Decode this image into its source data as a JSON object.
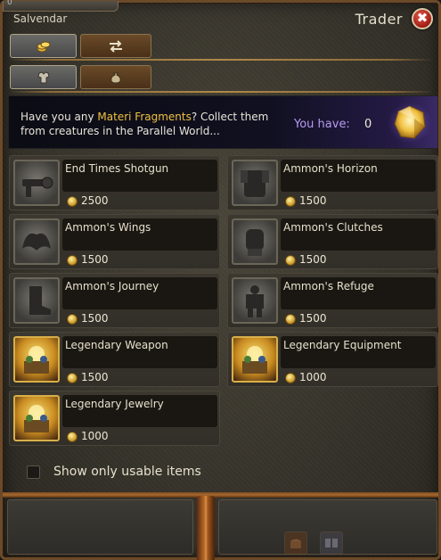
{
  "window": {
    "npc_name": "Salvendar",
    "title": "Trader",
    "top_stub_value": "0",
    "close_glyph": "✖"
  },
  "tabs_top": [
    {
      "icon": "gold-coins-icon",
      "active": true
    },
    {
      "icon": "exchange-arrows-icon",
      "active": false
    }
  ],
  "tabs_sub": [
    {
      "icon": "armor-icon",
      "active": true
    },
    {
      "icon": "bag-icon",
      "active": false
    }
  ],
  "banner": {
    "text_before": "Have you any ",
    "highlight": "Materi Fragments",
    "text_after": "? Collect them from creatures in the Parallel World...",
    "you_have_label": "You have:",
    "you_have_value": "0",
    "fragment_icon": "materi-fragment-icon",
    "highlight_color": "#f0c040"
  },
  "items": [
    {
      "name": "End Times Shotgun",
      "price": "2500",
      "icon": "shotgun-icon",
      "gold": false
    },
    {
      "name": "Ammon's Horizon",
      "price": "1500",
      "icon": "armor-chest-icon",
      "gold": false
    },
    {
      "name": "Ammon's Wings",
      "price": "1500",
      "icon": "wings-icon",
      "gold": false
    },
    {
      "name": "Ammon's Clutches",
      "price": "1500",
      "icon": "gauntlets-icon",
      "gold": false
    },
    {
      "name": "Ammon's Journey",
      "price": "1500",
      "icon": "boots-icon",
      "gold": false
    },
    {
      "name": "Ammon's Refuge",
      "price": "1500",
      "icon": "armor-suit-icon",
      "gold": false
    },
    {
      "name": "Legendary Weapon",
      "price": "1500",
      "icon": "legendary-chest-icon",
      "gold": true
    },
    {
      "name": "Legendary Equipment",
      "price": "1000",
      "icon": "legendary-chest-icon",
      "gold": true
    },
    {
      "name": "Legendary Jewelry",
      "price": "1000",
      "icon": "legendary-chest-icon",
      "gold": true
    }
  ],
  "filter": {
    "label": "Show only usable items",
    "checked": false
  }
}
